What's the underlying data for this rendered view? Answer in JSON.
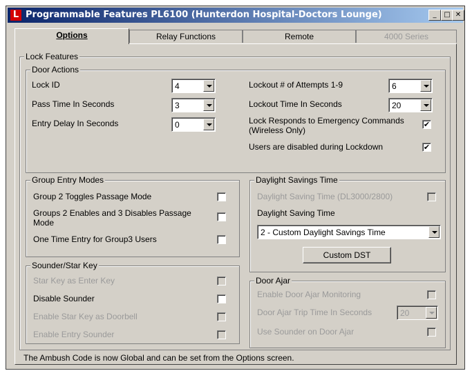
{
  "window": {
    "title": "Programmable Features PL6100 (Hunterdon Hospital-Doctors Lounge)",
    "app_icon_glyph": "L",
    "controls": {
      "minimize": "_",
      "maximize": "□",
      "close": "✕"
    }
  },
  "tabs": [
    {
      "label": "Options",
      "active": true
    },
    {
      "label": "Relay Functions",
      "active": false
    },
    {
      "label": "Remote",
      "active": false
    },
    {
      "label": "4000 Series",
      "active": false,
      "disabled": true
    }
  ],
  "lock_features": {
    "legend": "Lock Features",
    "door_actions": {
      "legend": "Door Actions",
      "lock_id": {
        "label": "Lock ID",
        "value": "4"
      },
      "pass_time": {
        "label": "Pass Time In Seconds",
        "value": "3"
      },
      "entry_delay": {
        "label": "Entry Delay In Seconds",
        "value": "0"
      },
      "lockout_attempts": {
        "label": "Lockout # of Attempts 1-9",
        "value": "6"
      },
      "lockout_time": {
        "label": "Lockout Time In Seconds",
        "value": "20"
      },
      "emergency": {
        "label_line1": "Lock Responds to Emergency Commands",
        "label_line2": "(Wireless Only)",
        "checked": true
      },
      "lockdown": {
        "label": "Users are disabled during Lockdown",
        "checked": true
      }
    },
    "group_entry": {
      "legend": "Group Entry Modes",
      "toggle_passage": {
        "label": "Group 2 Toggles Passage Mode",
        "checked": false
      },
      "enables_disables": {
        "label_line1": "Groups 2 Enables and 3 Disables Passage",
        "label_line2": "Mode",
        "checked": false
      },
      "one_time": {
        "label": "One Time Entry for Group3 Users",
        "checked": false
      }
    },
    "sounder": {
      "legend": "Sounder/Star Key",
      "star_enter": {
        "label": "Star Key as Enter Key",
        "checked": false,
        "disabled": true
      },
      "disable_sounder": {
        "label": "Disable Sounder",
        "checked": false
      },
      "star_doorbell": {
        "label": "Enable Star Key as Doorbell",
        "checked": false,
        "disabled": true
      },
      "entry_sounder": {
        "label": "Enable Entry Sounder",
        "checked": false,
        "disabled": true
      }
    },
    "dst": {
      "legend": "Daylight Savings Time",
      "dl3000": {
        "label": "Daylight Saving Time (DL3000/2800)",
        "checked": false,
        "disabled": true
      },
      "dst_label": "Daylight Saving Time",
      "dst_value": "2 - Custom Daylight Savings Time",
      "custom_button": "Custom DST"
    },
    "door_ajar": {
      "legend": "Door Ajar",
      "enable_monitor": {
        "label": "Enable Door Ajar Monitoring",
        "checked": false,
        "disabled": true
      },
      "trip_time": {
        "label": "Door Ajar Trip Time In Seconds",
        "value": "20",
        "disabled": true
      },
      "use_sounder": {
        "label": "Use Sounder on Door Ajar",
        "checked": false,
        "disabled": true
      }
    }
  },
  "footer_note": "The Ambush Code is now Global and can be set from the Options screen.",
  "colors": {
    "title_start": "#0a246a",
    "title_end": "#a6caf0",
    "face": "#d4d0c8",
    "disabled_text": "#9a9a9a",
    "app_icon": "#d40000"
  }
}
